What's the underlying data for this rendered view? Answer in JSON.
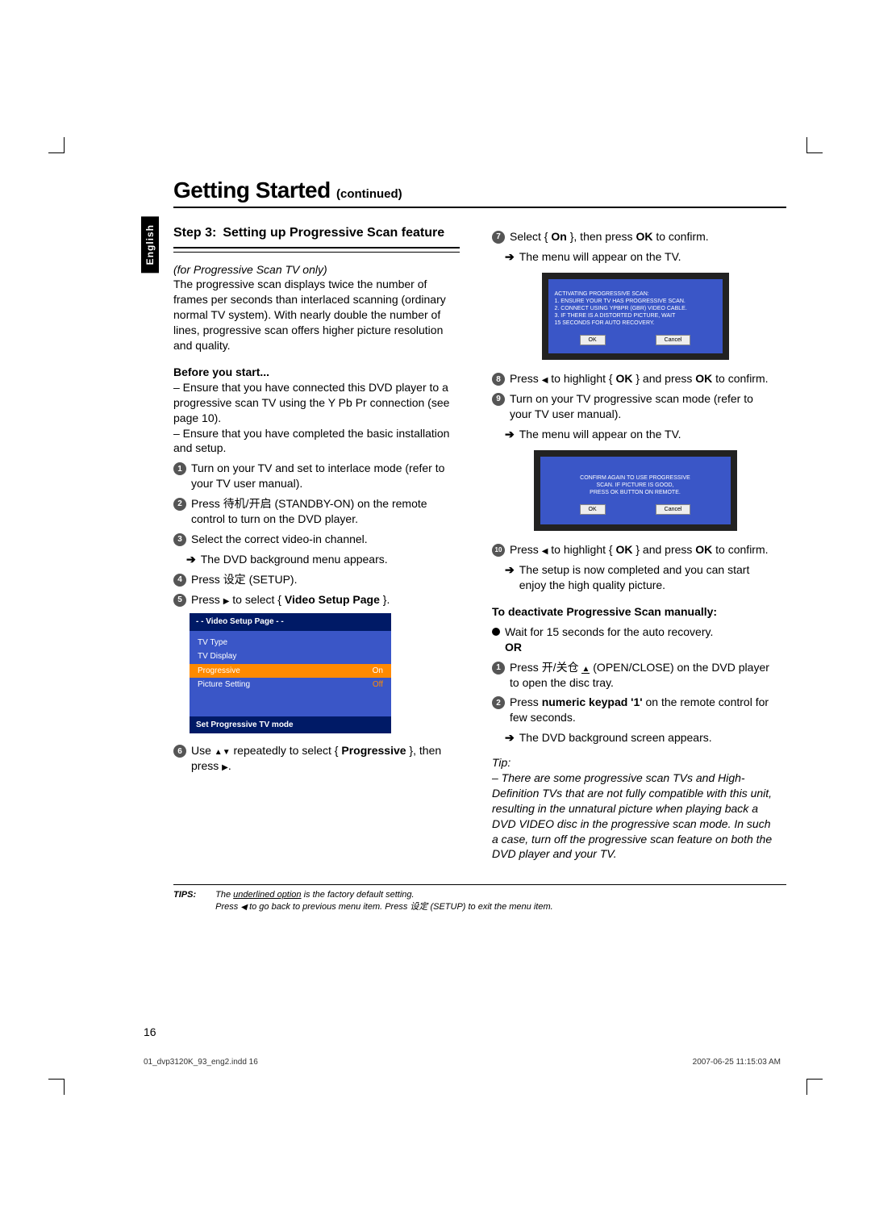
{
  "title": "Getting Started",
  "title_cont": "(continued)",
  "lang_tab": "English",
  "step": {
    "num": "Step 3:",
    "title": "Setting up Progressive Scan feature"
  },
  "left": {
    "subtitle_italic": "for Progressive Scan TV only)",
    "intro": "The progressive scan displays twice the number of frames per seconds than interlaced scanning (ordinary normal TV system). With nearly double the number of lines, progressive scan offers higher picture resolution and quality.",
    "before_label": "Before you start...",
    "before1": "– Ensure that you have connected this DVD player to a progressive scan TV using the Y Pb Pr connection (see page 10).",
    "before2": "– Ensure that you have completed the basic installation and setup.",
    "s1": "Turn on your TV and set to interlace mode (refer to your TV user manual).",
    "s2a": "Press ",
    "s2b": " (STANDBY-ON) on the remote control to turn on the DVD player.",
    "s2cjk": "待机/开启",
    "s3": "Select the correct video-in channel.",
    "s3sub": "The DVD background menu appears.",
    "s4a": "Press ",
    "s4cjk": "设定",
    "s4b": " (SETUP).",
    "s5a": "Press ",
    "s5b": " to select { ",
    "s5bold": "Video Setup Page",
    "s5c": " }.",
    "osd": {
      "header": "- -   Video Setup Page    - -",
      "r1": "TV Type",
      "r2": "TV Display",
      "r3l": "Progressive",
      "r3r": "On",
      "r4l": "Picture Setting",
      "r4r": "Off",
      "footer": "Set Progressive TV mode"
    },
    "s6a": "Use ",
    "s6b": " repeatedly to select { ",
    "s6bold": "Progressive",
    "s6c": " }, then press ",
    "s6d": "."
  },
  "right": {
    "s7a": "Select { ",
    "s7on": "On",
    "s7b": " }, then press ",
    "s7ok": "OK",
    "s7c": " to confirm.",
    "s7sub": "The menu will appear on the TV.",
    "dlg1": {
      "l1": "ACTIVATING PROGRESSIVE SCAN:",
      "l2": "1. ENSURE YOUR TV HAS PROGRESSIVE SCAN.",
      "l3": "2. CONNECT USING YPBPR (GBR) VIDEO CABLE.",
      "l4": "3. IF THERE IS A DISTORTED PICTURE, WAIT",
      "l5": "   15 SECONDS FOR AUTO RECOVERY.",
      "ok": "OK",
      "cancel": "Cancel"
    },
    "s8a": "Press ",
    "s8b": " to highlight { ",
    "s8ok": "OK",
    "s8c": " } and press ",
    "s8d": " to confirm.",
    "s9a": "Turn on your TV progressive scan mode (refer to your TV user manual).",
    "s9sub": "The menu will appear on the TV.",
    "dlg2": {
      "l1": "CONFIRM AGAIN TO USE PROGRESSIVE",
      "l2": "SCAN. IF PICTURE IS GOOD,",
      "l3": "PRESS OK BUTTON ON REMOTE.",
      "ok": "OK",
      "cancel": "Cancel"
    },
    "s10a": "Press ",
    "s10b": " to highlight { ",
    "s10ok": "OK",
    "s10c": " } and press ",
    "s10d": " to confirm.",
    "s10sub": "The setup is now completed and you can start enjoy the high quality picture.",
    "deact_head": "To deactivate Progressive Scan manually:",
    "deact_wait": "Wait for 15 seconds for the auto recovery.",
    "or": "OR",
    "d1a": "Press ",
    "d1cjk": "开/关仓",
    "d1b": " (OPEN/CLOSE) on the DVD player to open the disc tray.",
    "d2a": "Press ",
    "d2bold": "numeric keypad '1'",
    "d2b": " on the remote control for few seconds.",
    "d2sub": "The DVD background screen appears.",
    "tip_label": "Tip:",
    "tip": "– There are some progressive scan TVs and High-Definition TVs that are not fully compatible with this unit, resulting in the unnatural picture when playing back a DVD VIDEO disc in the progressive scan mode. In such a case, turn off the progressive scan feature on both the DVD player and your TV."
  },
  "tips": {
    "label": "TIPS:",
    "l1a": "The ",
    "l1u": "underlined option",
    "l1b": " is the factory default setting.",
    "l2a": "Press ",
    "l2b": " to go back to previous menu item. Press ",
    "l2cjk": "设定",
    "l2c": " (SETUP) to exit the menu item."
  },
  "page_number": "16",
  "footer_file": "01_dvp3120K_93_eng2.indd   16",
  "footer_date": "2007-06-25   11:15:03 AM"
}
